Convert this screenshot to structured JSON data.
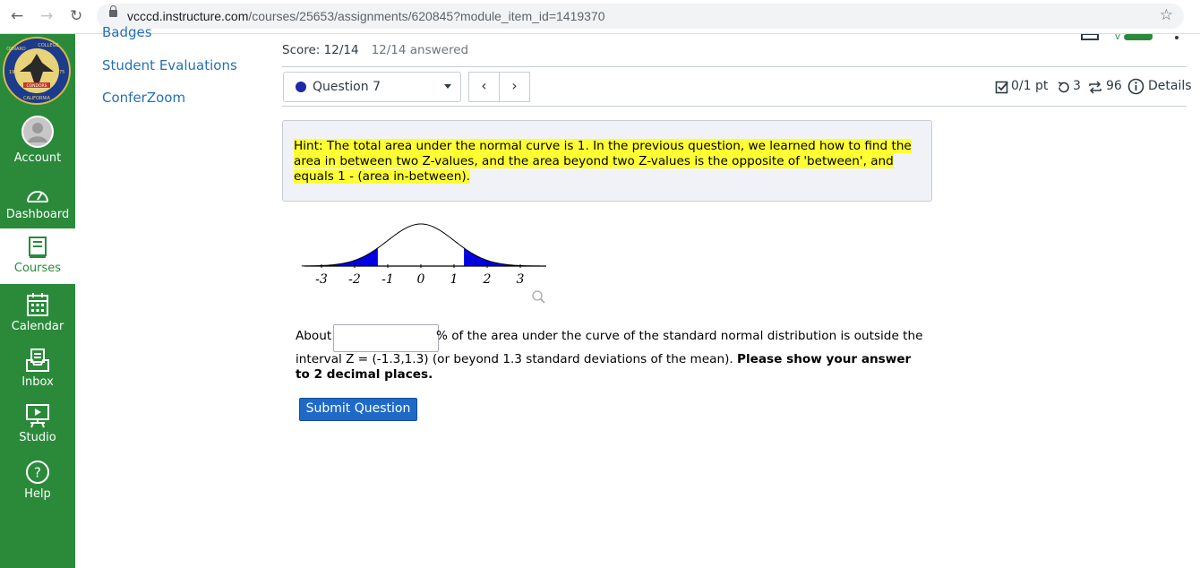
{
  "browser": {
    "url_host": "vcccd.instructure.com",
    "url_path": "/courses/25653/assignments/620845?module_item_id=1419370"
  },
  "global_nav": {
    "items": [
      {
        "label": "Account"
      },
      {
        "label": "Dashboard"
      },
      {
        "label": "Courses"
      },
      {
        "label": "Calendar"
      },
      {
        "label": "Inbox"
      },
      {
        "label": "Studio"
      },
      {
        "label": "Help"
      }
    ],
    "logo_text": {
      "top": "COLLEGE",
      "left": "OXNARD",
      "bottom": "CALIFORNIA",
      "banner": "CONDORS",
      "year_left": "19",
      "year_right": "75"
    }
  },
  "course_nav": {
    "items": [
      {
        "label": "Badges"
      },
      {
        "label": "Student Evaluations"
      },
      {
        "label": "ConferZoom"
      }
    ]
  },
  "quiz": {
    "score": "Score: 12/14",
    "answered": "12/14 answered",
    "question_label": "Question 7",
    "points": "0/1 pt",
    "retries": "3",
    "attempts": "96",
    "details": "Details"
  },
  "hint": "Hint: The total area under the normal curve is 1.  In the previous question, we learned how to find the area in between two Z-values, and the area beyond two Z-values is the opposite of 'between', and equals 1 - (area in-between).",
  "graph": {
    "ticks": [
      "-3",
      "-2",
      "-1",
      "0",
      "1",
      "2",
      "3"
    ],
    "shaded_beyond": 1.3
  },
  "question": {
    "prefix": "About",
    "suffix": "% of the area under the curve of the standard normal distribution is outside the",
    "line2": "interval Z = (-1.3,1.3) (or beyond 1.3 standard deviations of the mean).",
    "bold": "Please show your answer to 2 decimal places.",
    "input_value": ""
  },
  "submit_label": "Submit Question",
  "colors": {
    "nav_green": "#2a8a3a",
    "link_blue": "#2471b5",
    "button_blue": "#1f6ac9",
    "hint_highlight": "#ffff33",
    "shade_blue": "#0000e0"
  }
}
